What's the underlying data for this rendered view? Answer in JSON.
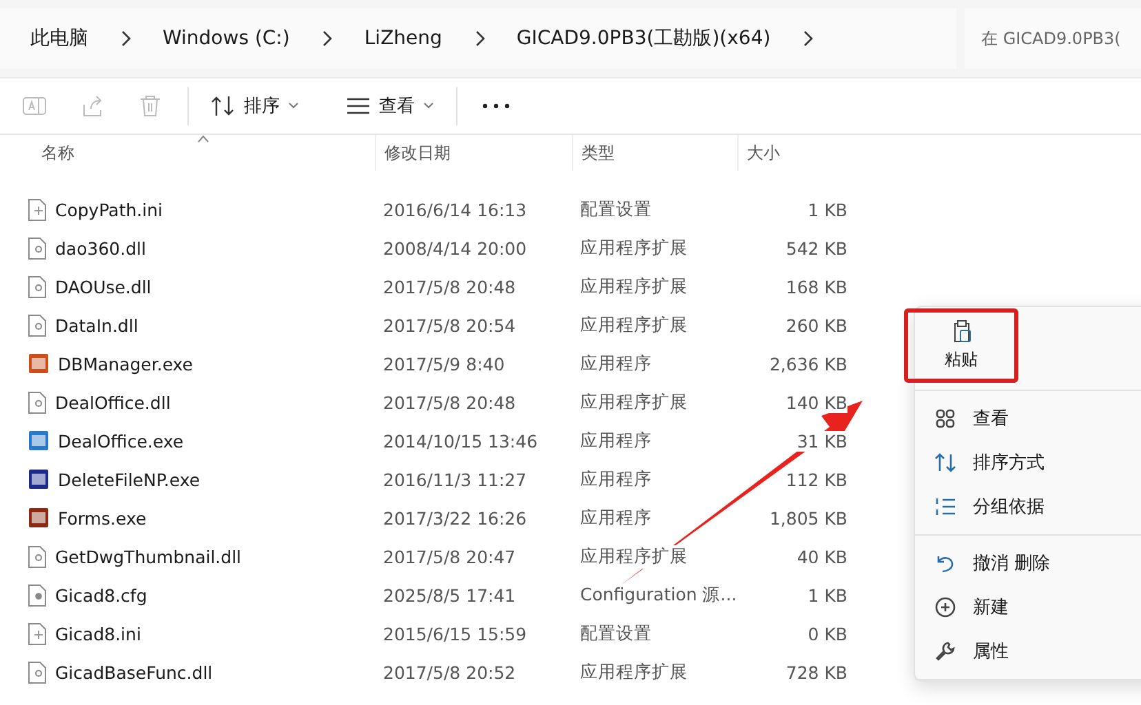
{
  "breadcrumb": [
    "此电脑",
    "Windows (C:)",
    "LiZheng",
    "GICAD9.0PB3(工勘版)(x64)"
  ],
  "search": {
    "placeholder": "在 GICAD9.0PB3("
  },
  "toolbar": {
    "sort": "排序",
    "view": "查看"
  },
  "columns": [
    "名称",
    "修改日期",
    "类型",
    "大小"
  ],
  "rows": [
    {
      "kind": "ini",
      "name": "CopyPath.ini",
      "date": "2016/6/14 16:13",
      "type": "配置设置",
      "size": "1 KB"
    },
    {
      "kind": "dll",
      "name": "dao360.dll",
      "date": "2008/4/14 20:00",
      "type": "应用程序扩展",
      "size": "542 KB"
    },
    {
      "kind": "dll",
      "name": "DAOUse.dll",
      "date": "2017/5/8 20:48",
      "type": "应用程序扩展",
      "size": "168 KB"
    },
    {
      "kind": "dll",
      "name": "DataIn.dll",
      "date": "2017/5/8 20:54",
      "type": "应用程序扩展",
      "size": "260 KB"
    },
    {
      "kind": "exe",
      "color": "#c8501e",
      "name": "DBManager.exe",
      "date": "2017/5/9 8:40",
      "type": "应用程序",
      "size": "2,636 KB"
    },
    {
      "kind": "dll",
      "name": "DealOffice.dll",
      "date": "2017/5/8 20:48",
      "type": "应用程序扩展",
      "size": "140 KB"
    },
    {
      "kind": "exe",
      "color": "#2a78c8",
      "name": "DealOffice.exe",
      "date": "2014/10/15 13:46",
      "type": "应用程序",
      "size": "31 KB"
    },
    {
      "kind": "exe",
      "color": "#1c2a8c",
      "name": "DeleteFileNP.exe",
      "date": "2016/11/3 11:27",
      "type": "应用程序",
      "size": "112 KB"
    },
    {
      "kind": "exe",
      "color": "#8a2a14",
      "name": "Forms.exe",
      "date": "2017/3/22 16:26",
      "type": "应用程序",
      "size": "1,805 KB"
    },
    {
      "kind": "dll",
      "name": "GetDwgThumbnail.dll",
      "date": "2017/5/8 20:47",
      "type": "应用程序扩展",
      "size": "40 KB"
    },
    {
      "kind": "cfg",
      "name": "Gicad8.cfg",
      "date": "2025/8/5 17:41",
      "type": "Configuration 源...",
      "size": "1 KB"
    },
    {
      "kind": "ini",
      "name": "Gicad8.ini",
      "date": "2015/6/15 15:59",
      "type": "配置设置",
      "size": "0 KB"
    },
    {
      "kind": "dll",
      "name": "GicadBaseFunc.dll",
      "date": "2017/5/8 20:52",
      "type": "应用程序扩展",
      "size": "728 KB"
    }
  ],
  "context_menu": {
    "paste": {
      "label": "粘贴",
      "annotated": true
    },
    "groups": [
      [
        {
          "kind": "view",
          "label": "查看"
        },
        {
          "kind": "sort",
          "label": "排序方式"
        },
        {
          "kind": "group",
          "label": "分组依据"
        }
      ],
      [
        {
          "kind": "undo",
          "label": "撤消 删除"
        },
        {
          "kind": "new",
          "label": "新建"
        },
        {
          "kind": "properties",
          "label": "属性"
        }
      ]
    ]
  },
  "annotation_arrow": true
}
